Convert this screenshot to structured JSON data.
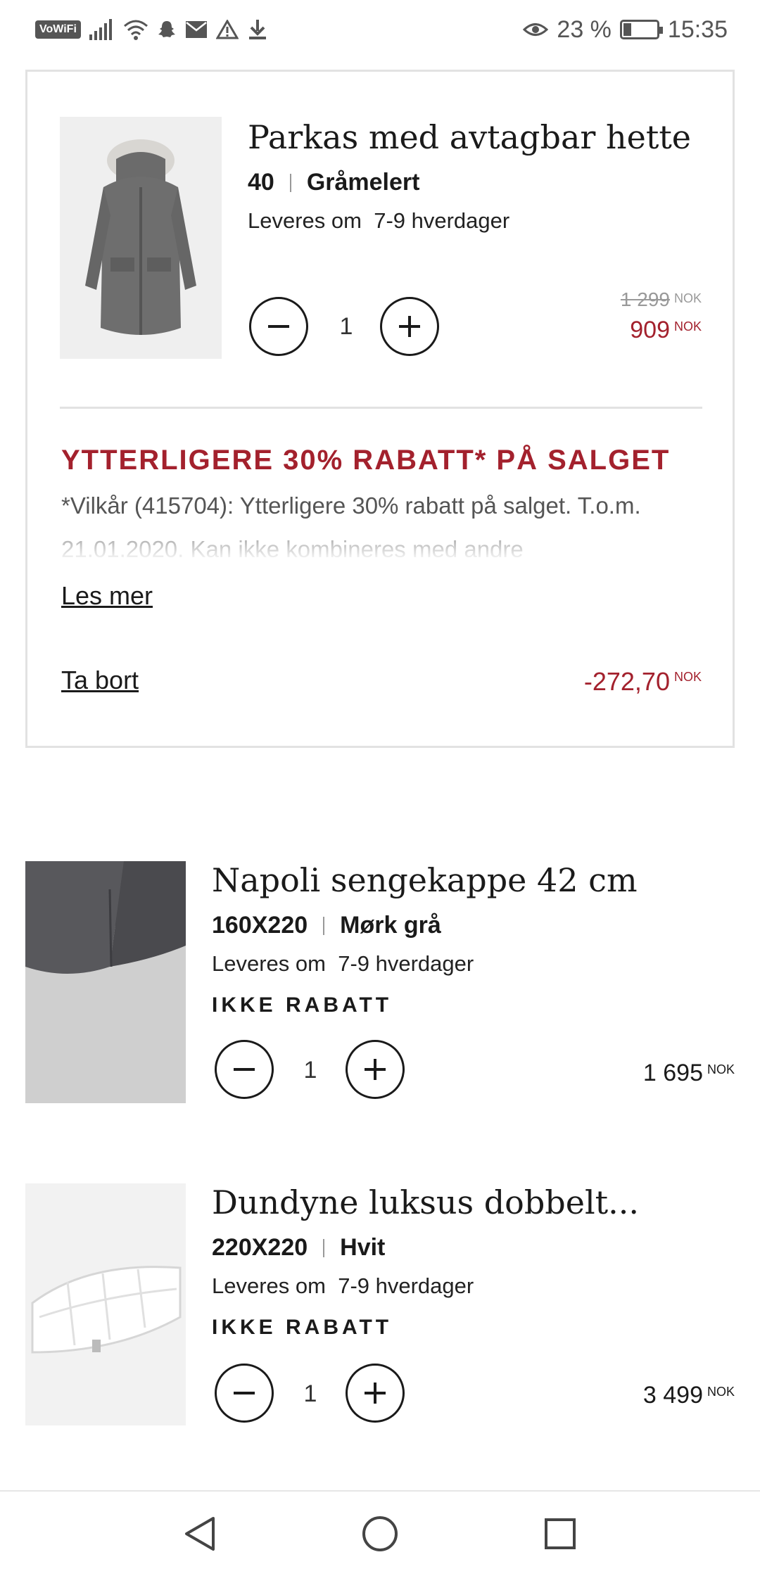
{
  "status_bar": {
    "vowifi": "VoWiFi",
    "battery_percent": "23 %",
    "battery_level": 0.23,
    "time": "15:35",
    "icons": [
      "signal-icon",
      "wifi-icon",
      "snapchat-icon",
      "mail-icon",
      "warning-icon",
      "download-icon",
      "eye-icon",
      "battery-icon"
    ]
  },
  "items": [
    {
      "title": "Parkas med avtagbar hette",
      "size": "40",
      "color": "Gråmelert",
      "delivery_label": "Leveres om",
      "delivery_time": "7-9 hverdager",
      "quantity": "1",
      "old_price": "1 299",
      "price": "909",
      "currency": "NOK",
      "promo": {
        "title": "YTTERLIGERE 30% RABATT* PÅ SALGET",
        "text": "*Vilkår (415704): Ytterligere 30% rabatt på salget. T.o.m. 21.01.2020. Kan ikke kombineres med andre",
        "read_more": "Les mer",
        "remove": "Ta bort",
        "discount": "-272,70",
        "currency": "NOK"
      }
    },
    {
      "title": "Napoli sengekappe 42 cm",
      "size": "160X220",
      "color": "Mørk grå",
      "delivery_label": "Leveres om",
      "delivery_time": "7-9 hverdager",
      "badge": "IKKE RABATT",
      "quantity": "1",
      "price": "1 695",
      "currency": "NOK"
    },
    {
      "title": "Dundyne luksus dobbelt...",
      "size": "220X220",
      "color": "Hvit",
      "delivery_label": "Leveres om",
      "delivery_time": "7-9 hverdager",
      "badge": "IKKE RABATT",
      "quantity": "1",
      "price": "3 499",
      "currency": "NOK"
    }
  ],
  "colors": {
    "sale_red": "#a3212d",
    "border": "#e2e2e2",
    "text": "#1a1a1a"
  },
  "nav": {
    "icons": [
      "back-triangle-icon",
      "home-circle-icon",
      "recents-square-icon"
    ]
  }
}
